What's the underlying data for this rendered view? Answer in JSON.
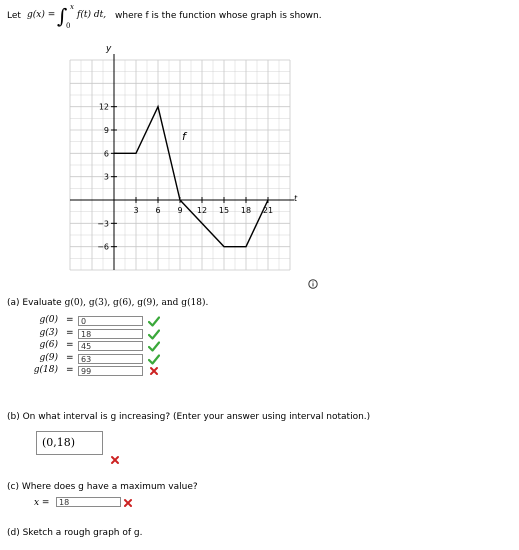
{
  "intro": {
    "prefix": "Let",
    "gx": "g(x) =",
    "integral_upper": "x",
    "integral_lower": "0",
    "integrand": "f(t) dt,",
    "suffix": "where f is the function whose graph is shown."
  },
  "graph": {
    "y_axis_label": "y",
    "t_axis_label": "t",
    "function_label": "f",
    "x_tick_labels": [
      "3",
      "6",
      "9",
      "12",
      "15",
      "18",
      "21"
    ],
    "y_tick_labels": [
      "12",
      "9",
      "6",
      "3",
      "−3",
      "−6"
    ],
    "info_icon": "info-icon"
  },
  "chart_data": {
    "type": "line",
    "title": "",
    "xlabel": "t",
    "ylabel": "y",
    "xlim": [
      -6,
      24
    ],
    "ylim": [
      -9,
      18
    ],
    "grid": true,
    "series": [
      {
        "name": "f",
        "x": [
          0,
          3,
          6,
          9,
          15,
          18,
          21
        ],
        "y": [
          6,
          6,
          12,
          0,
          -6,
          -6,
          0
        ]
      }
    ]
  },
  "part_a": {
    "question_prefix": "(a)  Evaluate",
    "question_items": "g(0), g(3), g(6), g(9), and g(18).",
    "rows": [
      {
        "label": "g(0)",
        "eq": "=",
        "value": "0",
        "status": "correct"
      },
      {
        "label": "g(3)",
        "eq": "=",
        "value": "18",
        "status": "correct"
      },
      {
        "label": "g(6)",
        "eq": "=",
        "value": "45",
        "status": "correct"
      },
      {
        "label": "g(9)",
        "eq": "=",
        "value": "63",
        "status": "correct"
      },
      {
        "label": "g(18)",
        "eq": "=",
        "value": "99",
        "status": "incorrect"
      }
    ]
  },
  "part_b": {
    "question": "(b)  On what interval is g increasing? (Enter your answer using interval notation.)",
    "answer": "(0,18)",
    "status": "incorrect"
  },
  "part_c": {
    "question": "(c)  Where does g have a maximum value?",
    "x_label": "x =",
    "answer": "18",
    "status": "incorrect"
  },
  "part_d": {
    "question": "(d)  Sketch a rough graph of g."
  },
  "colors": {
    "correct": "#3aa83a",
    "incorrect": "#cc2222",
    "grid": "#c8c8c8",
    "curve": "#000000"
  }
}
